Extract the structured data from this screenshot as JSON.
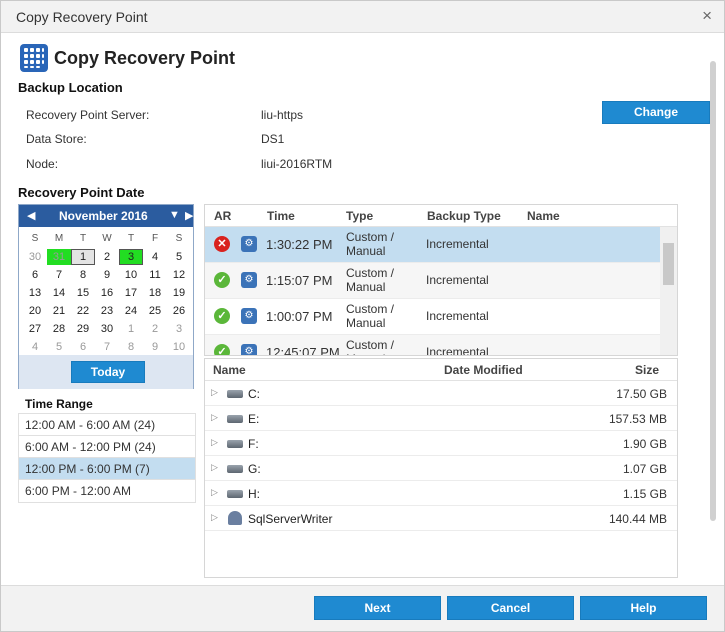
{
  "window": {
    "title": "Copy Recovery Point",
    "close_icon": "×"
  },
  "header": {
    "title": "Copy Recovery Point",
    "icon": "grid-app-icon"
  },
  "backup_location": {
    "heading": "Backup Location",
    "fields": [
      {
        "label": "Recovery Point Server:",
        "value": "liu-https"
      },
      {
        "label": "Data Store:",
        "value": "DS1"
      },
      {
        "label": "Node:",
        "value": "liui-2016RTM"
      }
    ],
    "change_label": "Change"
  },
  "recovery_point_date": {
    "heading": "Recovery Point Date"
  },
  "calendar": {
    "month_label": "November 2016",
    "weekdays": [
      "S",
      "M",
      "T",
      "W",
      "T",
      "F",
      "S"
    ],
    "weeks": [
      [
        {
          "d": "30",
          "o": 1
        },
        {
          "d": "31",
          "o": 1,
          "b": 1
        },
        {
          "d": "1",
          "s": 1
        },
        {
          "d": "2"
        },
        {
          "d": "3",
          "b": 1,
          "s": 1
        },
        {
          "d": "4"
        },
        {
          "d": "5"
        }
      ],
      [
        {
          "d": "6"
        },
        {
          "d": "7"
        },
        {
          "d": "8"
        },
        {
          "d": "9"
        },
        {
          "d": "10"
        },
        {
          "d": "11"
        },
        {
          "d": "12"
        }
      ],
      [
        {
          "d": "13"
        },
        {
          "d": "14"
        },
        {
          "d": "15"
        },
        {
          "d": "16"
        },
        {
          "d": "17"
        },
        {
          "d": "18"
        },
        {
          "d": "19"
        }
      ],
      [
        {
          "d": "20"
        },
        {
          "d": "21"
        },
        {
          "d": "22"
        },
        {
          "d": "23"
        },
        {
          "d": "24"
        },
        {
          "d": "25"
        },
        {
          "d": "26"
        }
      ],
      [
        {
          "d": "27"
        },
        {
          "d": "28"
        },
        {
          "d": "29"
        },
        {
          "d": "30"
        },
        {
          "d": "1",
          "o": 1
        },
        {
          "d": "2",
          "o": 1
        },
        {
          "d": "3",
          "o": 1
        }
      ],
      [
        {
          "d": "4",
          "o": 1
        },
        {
          "d": "5",
          "o": 1
        },
        {
          "d": "6",
          "o": 1
        },
        {
          "d": "7",
          "o": 1
        },
        {
          "d": "8",
          "o": 1
        },
        {
          "d": "9",
          "o": 1
        },
        {
          "d": "10",
          "o": 1
        }
      ]
    ],
    "today_label": "Today"
  },
  "time_range": {
    "heading": "Time Range",
    "items": [
      {
        "label": "12:00 AM - 6:00 AM   (24)"
      },
      {
        "label": "6:00 AM - 12:00 PM   (24)"
      },
      {
        "label": "12:00 PM - 6:00 PM   (7)",
        "selected": true
      },
      {
        "label": "6:00 PM - 12:00 AM"
      }
    ]
  },
  "recovery_points": {
    "columns": {
      "ar": "AR",
      "time": "Time",
      "type": "Type",
      "backup_type": "Backup Type",
      "name": "Name"
    },
    "rows": [
      {
        "status": "error",
        "time": "1:30:22 PM",
        "type": "Custom / Manual",
        "backup_type": "Incremental",
        "name": "",
        "selected": true
      },
      {
        "status": "ok",
        "time": "1:15:07 PM",
        "type": "Custom / Manual",
        "backup_type": "Incremental",
        "name": ""
      },
      {
        "status": "ok",
        "time": "1:00:07 PM",
        "type": "Custom / Manual",
        "backup_type": "Incremental",
        "name": ""
      },
      {
        "status": "ok",
        "time": "12:45:07 PM",
        "type": "Custom / Manual",
        "backup_type": "Incremental",
        "name": ""
      }
    ]
  },
  "volumes": {
    "columns": {
      "name": "Name",
      "date_modified": "Date Modified",
      "size": "Size"
    },
    "rows": [
      {
        "name": "C:",
        "date_modified": "",
        "size": "17.50 GB",
        "icon": "drive-icon"
      },
      {
        "name": "E:",
        "date_modified": "",
        "size": "157.53 MB",
        "icon": "drive-icon"
      },
      {
        "name": "F:",
        "date_modified": "",
        "size": "1.90 GB",
        "icon": "drive-icon"
      },
      {
        "name": "G:",
        "date_modified": "",
        "size": "1.07 GB",
        "icon": "drive-icon"
      },
      {
        "name": "H:",
        "date_modified": "",
        "size": "1.15 GB",
        "icon": "drive-icon"
      },
      {
        "name": "SqlServerWriter",
        "date_modified": "",
        "size": "140.44 MB",
        "icon": "writer-icon"
      }
    ]
  },
  "footer": {
    "next_label": "Next",
    "cancel_label": "Cancel",
    "help_label": "Help"
  },
  "colors": {
    "accent": "#1f8ad1",
    "calendar_header": "#2b5c9f",
    "backup_day": "#22dd22",
    "selected_row": "#c3ddf0"
  }
}
